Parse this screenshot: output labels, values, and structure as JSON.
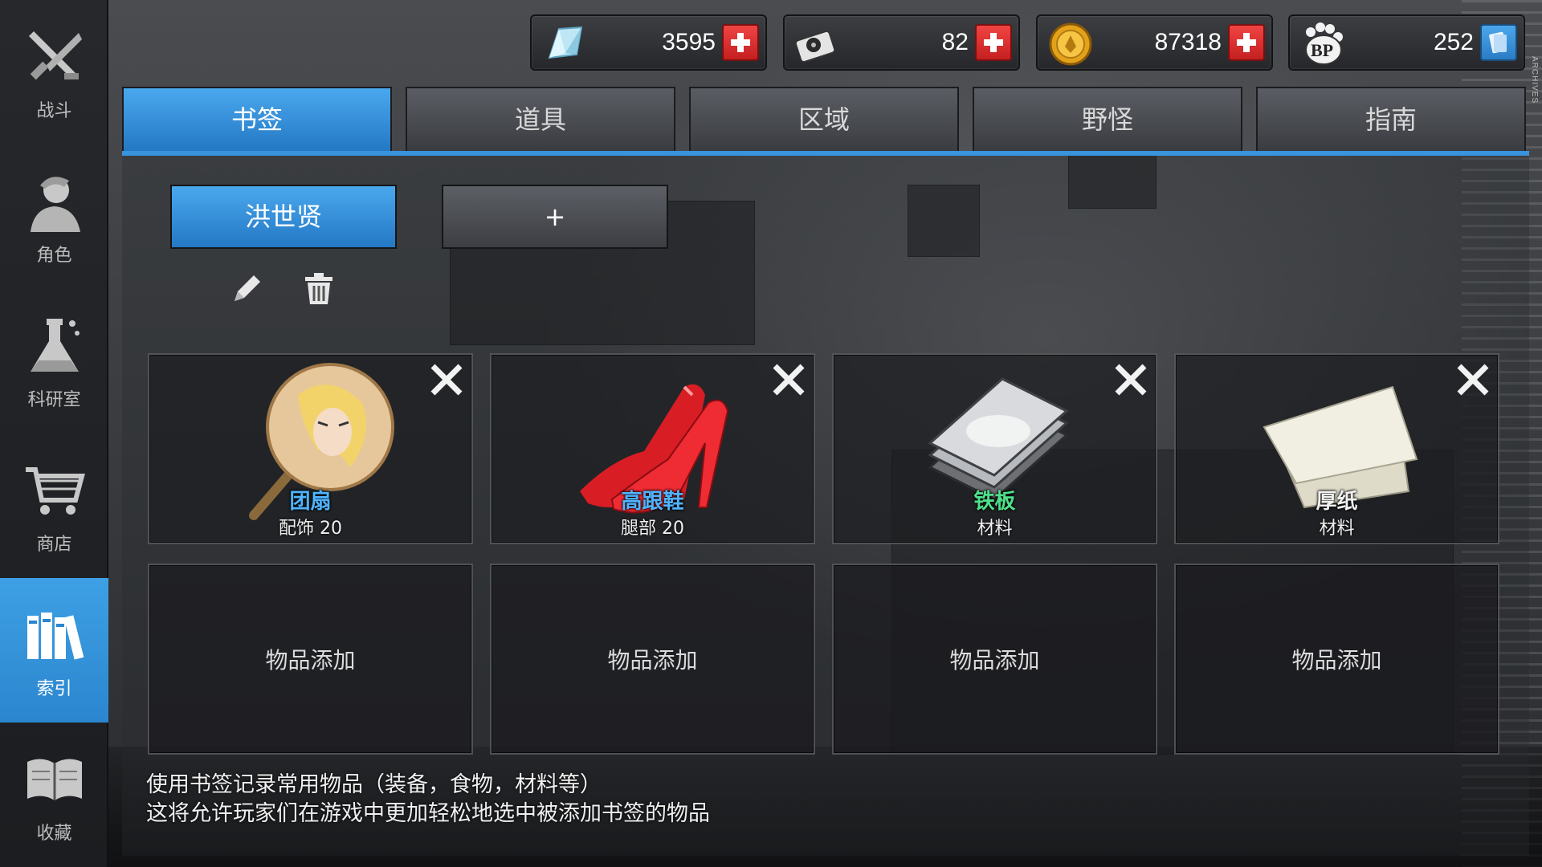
{
  "sidebar": {
    "items": [
      {
        "label": "战斗",
        "icon": "battle-icon"
      },
      {
        "label": "角色",
        "icon": "character-icon"
      },
      {
        "label": "科研室",
        "icon": "lab-flask-icon"
      },
      {
        "label": "商店",
        "icon": "shop-cart-icon"
      },
      {
        "label": "索引",
        "icon": "index-books-icon",
        "active": true
      },
      {
        "label": "收藏",
        "icon": "collection-book-icon"
      }
    ]
  },
  "currencies": [
    {
      "icon": "crystal-icon",
      "value": "3595",
      "action": "plus"
    },
    {
      "icon": "tape-icon",
      "value": "82",
      "action": "plus"
    },
    {
      "icon": "gold-coin-icon",
      "value": "87318",
      "action": "plus"
    },
    {
      "icon": "bp-paw-icon",
      "value": "252",
      "action": "exchange"
    }
  ],
  "tabs": [
    {
      "label": "书签",
      "active": true
    },
    {
      "label": "道具"
    },
    {
      "label": "区域"
    },
    {
      "label": "野怪"
    },
    {
      "label": "指南"
    }
  ],
  "bookmarks": {
    "active_label": "洪世贤",
    "add_label": "+"
  },
  "items": [
    {
      "name": "团扇",
      "name_color": "#4fb4ff",
      "sub": "配饰 20",
      "icon": "round-fan-icon"
    },
    {
      "name": "高跟鞋",
      "name_color": "#4fb4ff",
      "sub": "腿部 20",
      "icon": "high-heels-icon"
    },
    {
      "name": "铁板",
      "name_color": "#4fe08a",
      "sub": "材料",
      "icon": "iron-plate-icon"
    },
    {
      "name": "厚纸",
      "name_color": "#f0f0f0",
      "sub": "材料",
      "icon": "thick-paper-icon"
    }
  ],
  "empty_slot_label": "物品添加",
  "hint": {
    "line1": "使用书签记录常用物品（装备，食物，材料等）",
    "line2": "这将允许玩家们在游戏中更加轻松地选中被添加书签的物品"
  },
  "corner_text": "ARCHIVES"
}
